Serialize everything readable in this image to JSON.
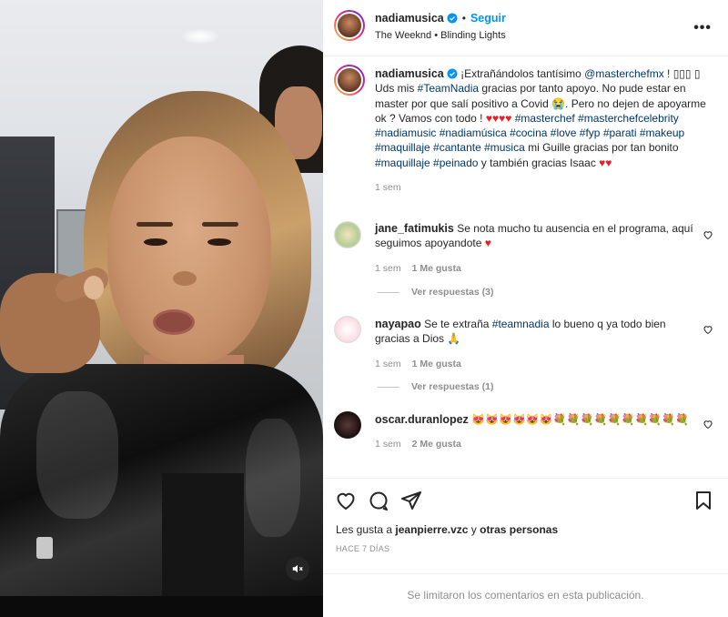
{
  "post": {
    "author": "nadiamusica",
    "follow_label": "Seguir",
    "audio_artist": "The Weeknd",
    "audio_separator": "•",
    "audio_track": "Blinding Lights",
    "more_label": "•••"
  },
  "caption": {
    "author": "nadiamusica",
    "text_1": "¡Extrañándolos tantísimo ",
    "mention": "@masterchefmx",
    "text_2": " ! ▯▯▯ ▯ Uds mis ",
    "tag_teamnadia": "#TeamNadia",
    "text_3": " gracias por tanto apoyo. No pude estar en master por que salí positivo a Covid 😭. Pero no dejen de apoyarme ok ? Vamos con todo ! ",
    "hearts_1": "♥♥♥♥",
    "tags_block": "#masterchef #masterchefcelebrity #nadiamusic #nadiamúsica #cocina #love #fyp #parati #makeup #maquillaje #cantante #musica",
    "text_4": " mi Guille gracias por tan bonito ",
    "tag_maquillaje": "#maquillaje",
    "text_5": " ",
    "tag_peinado": "#peinado",
    "text_6": " y también gracias Isaac ",
    "hearts_2": "♥♥",
    "time": "1 sem"
  },
  "comments": [
    {
      "user": "jane_fatimukis",
      "text": "Se nota mucho tu ausencia en el programa, aquí seguimos apoyandote ",
      "heart": "♥",
      "time": "1 sem",
      "likes": "1 Me gusta",
      "replies": "Ver respuestas (3)"
    },
    {
      "user": "nayapao",
      "text_pre": "Se te extraña ",
      "tag": "#teamnadia",
      "text_post": " lo bueno q ya todo bien gracias a Dios 🙏",
      "time": "1 sem",
      "likes": "1 Me gusta",
      "replies": "Ver respuestas (1)"
    },
    {
      "user": "oscar.duranlopez",
      "text": "😻😻😻😻😻😻💐💐💐💐💐💐💐💐💐💐",
      "time": "1 sem",
      "likes": "2 Me gusta"
    }
  ],
  "likes": {
    "prefix": "Les gusta a ",
    "user": "jeanpierre.vzc",
    "middle": " y ",
    "others": "otras personas"
  },
  "date_label": "HACE 7 DÍAS",
  "footer_text": "Se limitaron los comentarios en esta publicación.",
  "colors": {
    "link": "#0095f6",
    "hashtag": "#00376b",
    "muted": "#8e8e8e",
    "heart": "#ed1c24"
  },
  "icons": [
    "verified-badge-icon",
    "more-options-icon",
    "heart-icon",
    "comment-icon",
    "share-icon",
    "bookmark-icon",
    "mute-icon"
  ]
}
